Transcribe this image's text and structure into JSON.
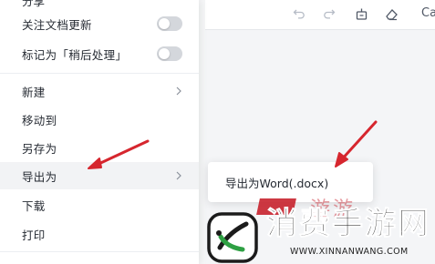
{
  "menu": {
    "partial_top_label": "分享",
    "items": [
      {
        "label": "关注文档更新",
        "type": "toggle",
        "on": false
      },
      {
        "label": "标记为「稍后处理」",
        "type": "toggle",
        "on": false
      },
      {
        "label": "新建",
        "type": "submenu"
      },
      {
        "label": "移动到",
        "type": "plain"
      },
      {
        "label": "另存为",
        "type": "plain"
      },
      {
        "label": "导出为",
        "type": "submenu",
        "active": true
      },
      {
        "label": "下载",
        "type": "plain"
      },
      {
        "label": "打印",
        "type": "plain"
      }
    ]
  },
  "submenu": {
    "items": [
      {
        "label": "导出为Word(.docx)"
      }
    ]
  },
  "toolbar": {
    "icons": [
      "undo-icon",
      "redo-icon",
      "format-painter-icon",
      "eraser-icon"
    ],
    "font_label": "Ca"
  },
  "watermark": {
    "title": "消费手游网",
    "url": "WWW.XINNANWANG.COM",
    "faint_text": "游游"
  },
  "colors": {
    "annotation_red": "#d6262e",
    "menu_bg": "#ffffff",
    "active_row": "#f2f3f5"
  }
}
